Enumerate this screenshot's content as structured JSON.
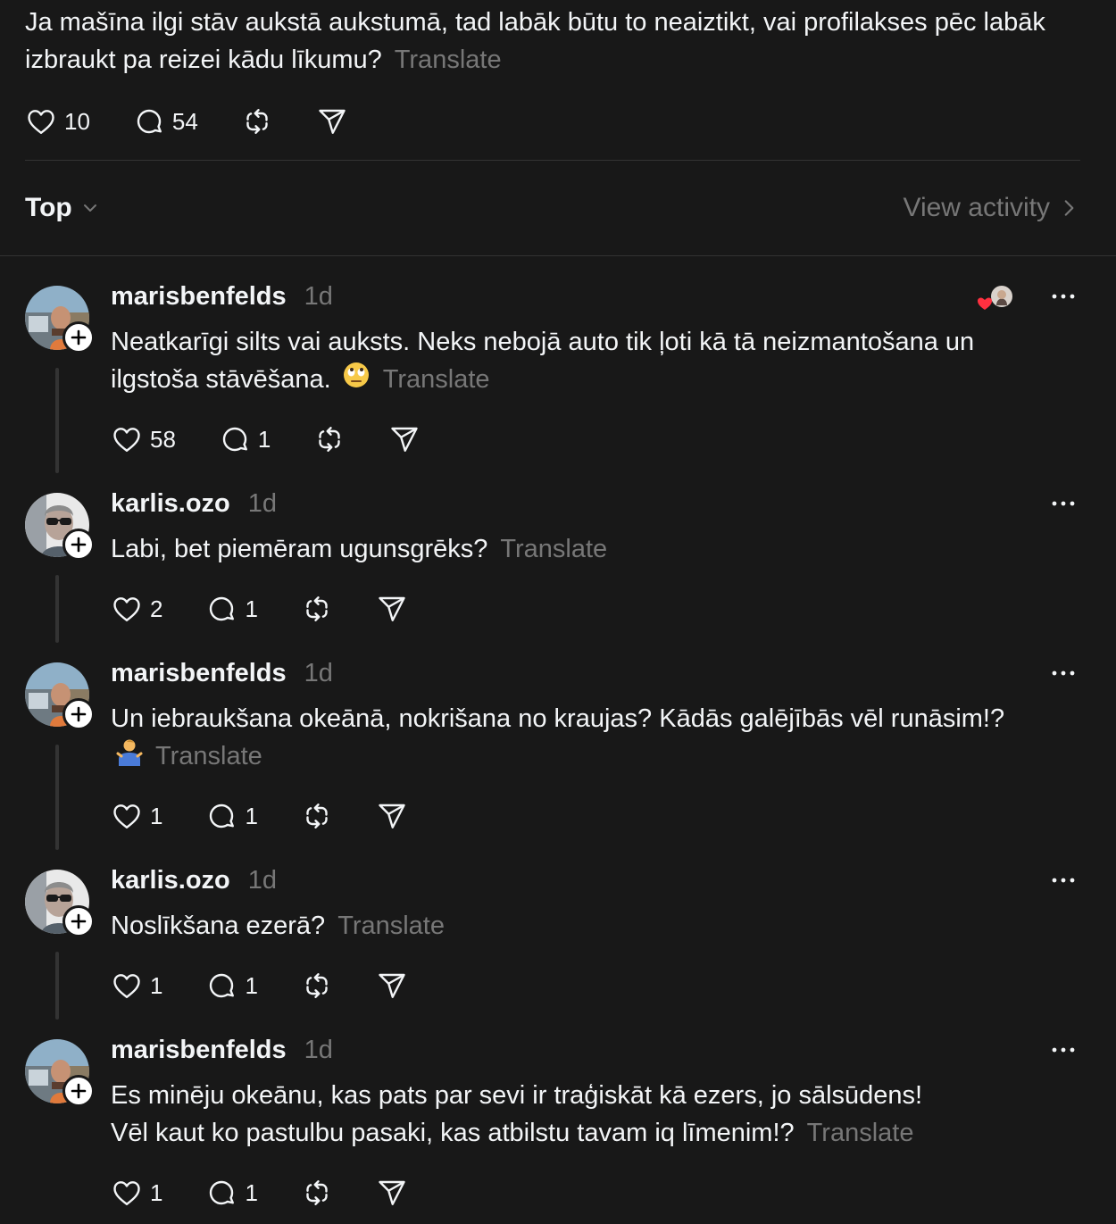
{
  "post": {
    "text": "Ja mašīna ilgi stāv aukstā aukstumā, tad labāk būtu to neaiztikt, vai profilakses pēc labāk izbraukt pa reizei kādu līkumu?",
    "translate_label": "Translate",
    "likes": "10",
    "comments": "54"
  },
  "sort": {
    "label": "Top",
    "view_activity": "View activity"
  },
  "replies": [
    {
      "username": "marisbenfelds",
      "time": "1d",
      "text": "Neatkarīgi silts vai auksts. Neks nebojā auto tik ļoti kā tā neizmantošana un ilgstoša stāvēšana.",
      "emoji": "face-with-rolling-eyes",
      "translate_label": "Translate",
      "likes": "58",
      "comments": "1"
    },
    {
      "username": "karlis.ozo",
      "time": "1d",
      "text": "Labi, bet piemēram ugunsgrēks?",
      "translate_label": "Translate",
      "likes": "2",
      "comments": "1"
    },
    {
      "username": "marisbenfelds",
      "time": "1d",
      "text": "Un iebraukšana okeānā, nokrišana no kraujas? Kādās galējībās vēl runāsim!?",
      "emoji": "man-shrugging",
      "translate_label": "Translate",
      "likes": "1",
      "comments": "1"
    },
    {
      "username": "karlis.ozo",
      "time": "1d",
      "text": "Noslīkšana ezerā?",
      "translate_label": "Translate",
      "likes": "1",
      "comments": "1"
    },
    {
      "username": "marisbenfelds",
      "time": "1d",
      "text_line1": "Es minēju okeānu, kas pats par sevi ir traģiskāt kā ezers, jo sālsūdens!",
      "text_line2": "Vēl kaut ko pastulbu pasaki, kas atbilstu tavam iq līmenim!?",
      "translate_label": "Translate",
      "likes": "1",
      "comments": "1"
    }
  ],
  "colors": {
    "background": "#181818",
    "text": "#f3f5f7",
    "secondary": "#777777",
    "divider": "#333333",
    "like_red": "#ff3040"
  }
}
